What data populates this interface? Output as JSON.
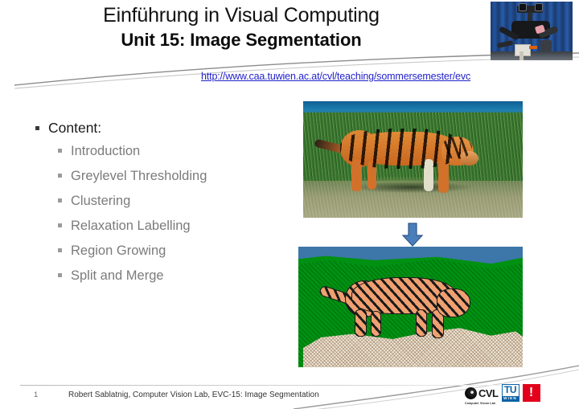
{
  "slide": {
    "title_line1": "Einführung in Visual Computing",
    "title_line2": "Unit 15: Image Segmentation",
    "course_url": "http://www.caa.tuwien.ac.at/cvl/teaching/sommersemester/evc"
  },
  "content": {
    "heading": "Content:",
    "items": [
      "Introduction",
      "Greylevel Thresholding",
      "Clustering",
      "Relaxation Labelling",
      "Region Growing",
      "Split and Merge"
    ]
  },
  "figures": {
    "source_photo_alt": "tiger-photograph",
    "arrow_alt": "down-arrow",
    "segmented_alt": "segmented-tiger-regions"
  },
  "footer": {
    "page_number": "1",
    "credit": "Robert Sablatnig, Computer Vision Lab, EVC-15: Image Segmentation"
  },
  "logos": {
    "cvl_name": "CVL",
    "cvl_subtitle": "Computer Vision Lab",
    "tu_name": "TU",
    "tu_city": "WIEN",
    "exclamation": "!"
  },
  "colors": {
    "link": "#2222cc",
    "bullet_sub_text": "#7b7b7b",
    "arrow_blue": "#4a7ebb",
    "seg_grass": "#009112",
    "seg_water": "#3d76a8",
    "seg_sand": "#efe9dc",
    "seg_tiger": "#f0a070",
    "tu_blue": "#0b63a8",
    "excl_red": "#e2001a"
  }
}
